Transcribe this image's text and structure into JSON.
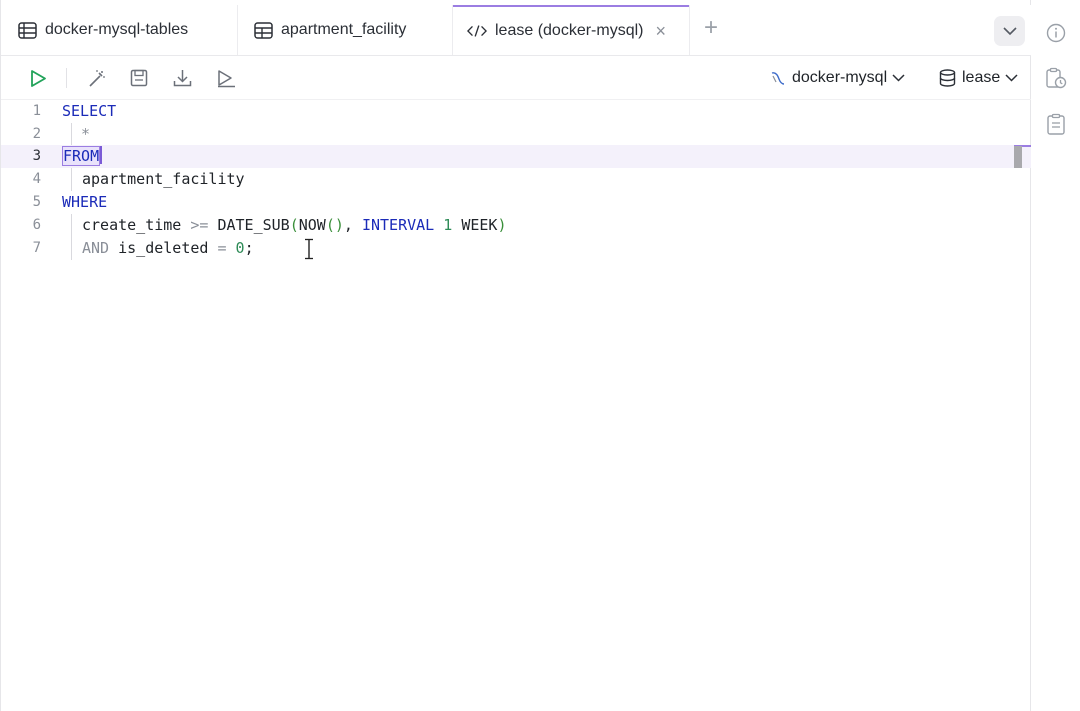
{
  "tabs": [
    {
      "label": "docker-mysql-tables",
      "icon": "table-list-icon",
      "active": false
    },
    {
      "label": "apartment_facility",
      "icon": "table-grid-icon",
      "active": false
    },
    {
      "label": "lease (docker-mysql)",
      "icon": "code-icon",
      "active": true
    }
  ],
  "tab_close_glyph": "×",
  "tab_add_glyph": "+",
  "toolbar": {
    "run_icon": "play-icon",
    "format_icon": "magic-wand-icon",
    "save_icon": "save-icon",
    "download_icon": "download-icon",
    "explain_icon": "explain-play-icon",
    "connection_label": "docker-mysql",
    "database_label": "lease"
  },
  "editor": {
    "line_numbers": [
      "1",
      "2",
      "3",
      "4",
      "5",
      "6",
      "7"
    ],
    "active_line": 3
  },
  "sql": {
    "l1_select": "SELECT",
    "l2_star": "*",
    "l3_from": "FROM",
    "l4_table": "apartment_facility",
    "l5_where": "WHERE",
    "l6_col": "create_time",
    "l6_op": ">=",
    "l6_fn": "DATE_SUB",
    "l6_open": "(",
    "l6_now": "NOW",
    "l6_nowparens": "()",
    "l6_comma": ",",
    "l6_interval": "INTERVAL",
    "l6_num": "1",
    "l6_unit": "WEEK",
    "l6_close": ")",
    "l7_and": "AND",
    "l7_col": "is_deleted",
    "l7_eq": "=",
    "l7_num": "0",
    "l7_semi": ";"
  },
  "rightbar": {
    "icons": [
      "info-icon",
      "clipboard-history-icon",
      "clipboard-list-icon"
    ]
  },
  "colors": {
    "accent": "#9b7de2",
    "run_green": "#22a35a",
    "keyword_blue": "#1b2bb8"
  }
}
